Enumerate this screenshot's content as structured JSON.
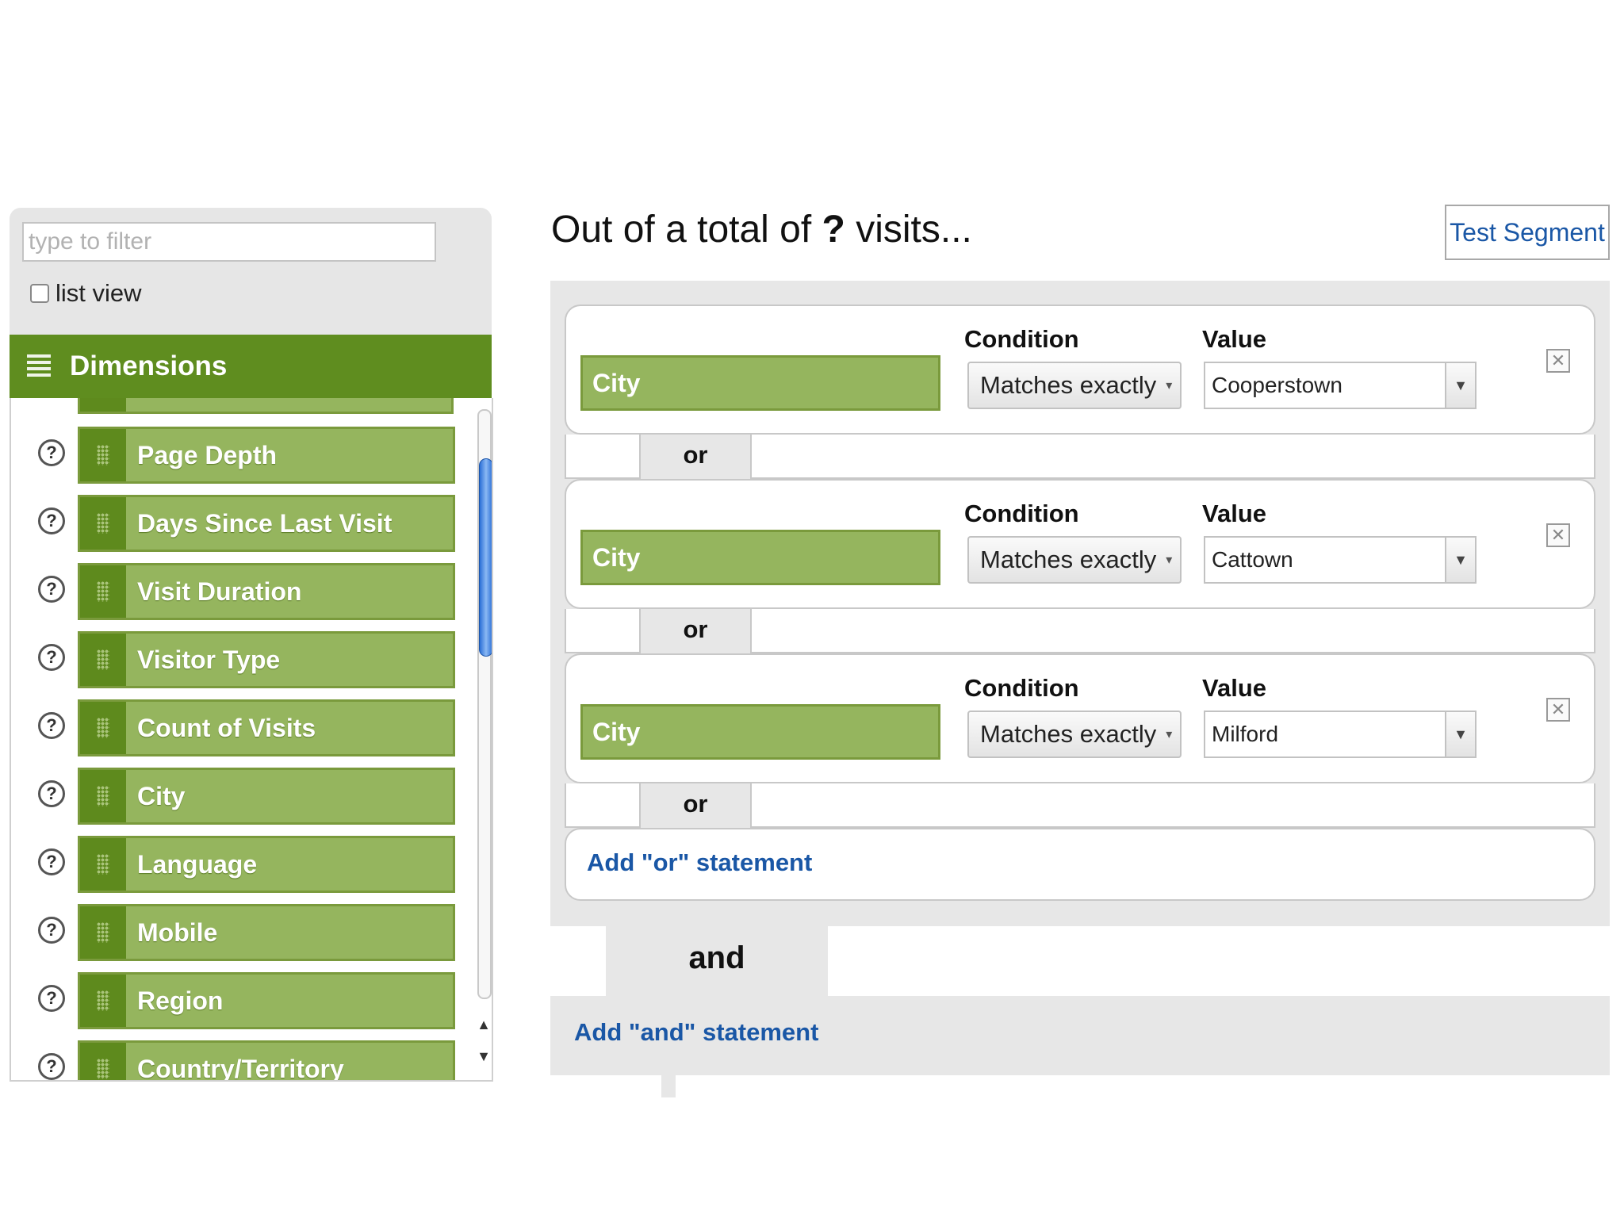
{
  "filter": {
    "placeholder": "type to filter",
    "list_view_label": "list view",
    "list_view_checked": false
  },
  "dimensions": {
    "header": "Dimensions",
    "items": [
      {
        "label": "Page Depth"
      },
      {
        "label": "Days Since Last Visit"
      },
      {
        "label": "Visit Duration"
      },
      {
        "label": "Visitor Type"
      },
      {
        "label": "Count of Visits"
      },
      {
        "label": "City"
      },
      {
        "label": "Language"
      },
      {
        "label": "Mobile"
      },
      {
        "label": "Region"
      },
      {
        "label": "Country/Territory"
      }
    ],
    "help_glyph": "?",
    "scroll_up": "▲",
    "scroll_down": "▼"
  },
  "segment": {
    "headline_prefix": "Out of a total of ",
    "headline_count": "?",
    "headline_suffix": " visits...",
    "test_button": "Test Segment",
    "or_statements": [
      {
        "dimension": "City",
        "condition_label": "Condition",
        "condition": "Matches exactly",
        "value_label": "Value",
        "value": "Cooperstown"
      },
      {
        "dimension": "City",
        "condition_label": "Condition",
        "condition": "Matches exactly",
        "value_label": "Value",
        "value": "Cattown"
      },
      {
        "dimension": "City",
        "condition_label": "Condition",
        "condition": "Matches exactly",
        "value_label": "Value",
        "value": "Milford"
      }
    ],
    "or_label": "or",
    "add_or": "Add \"or\" statement",
    "and_label": "and",
    "add_and": "Add \"and\" statement",
    "remove_glyph": "✕",
    "select_arrow": "▾",
    "drop_arrow": "▼"
  },
  "colors": {
    "dimension_green": "#95b55e",
    "dimension_dark_green": "#5f8d1f",
    "link_blue": "#1a57a6",
    "panel_grey": "#e7e7e7"
  }
}
